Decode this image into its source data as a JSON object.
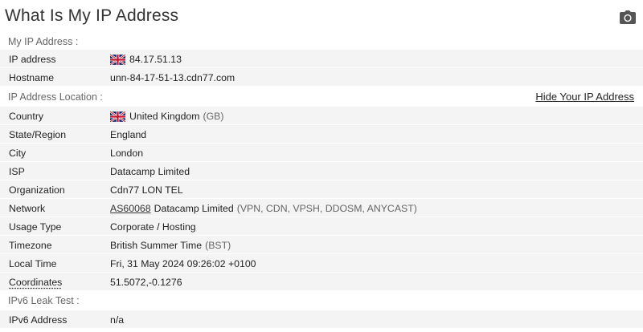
{
  "page": {
    "title": "What Is My IP Address"
  },
  "sections": {
    "my_ip": "My IP Address :",
    "location": "IP Address Location :",
    "ipv6": "IPv6 Leak Test :"
  },
  "hide_link": "Hide Your IP Address",
  "icons": {
    "camera": "camera-icon",
    "flag": "uk-flag-icon"
  },
  "ip": {
    "ip_label": "IP address",
    "ip_value": "84.17.51.13",
    "hostname_label": "Hostname",
    "hostname_value": "unn-84-17-51-13.cdn77.com"
  },
  "location": {
    "country_label": "Country",
    "country_value": "United Kingdom",
    "country_code": "(GB)",
    "state_label": "State/Region",
    "state_value": "England",
    "city_label": "City",
    "city_value": "London",
    "isp_label": "ISP",
    "isp_value": "Datacamp Limited",
    "org_label": "Organization",
    "org_value": "Cdn77 LON TEL",
    "network_label": "Network",
    "network_asn": "AS60068",
    "network_name": "Datacamp Limited",
    "network_extra": "(VPN, CDN, VPSH, DDOSM, ANYCAST)",
    "usage_label": "Usage Type",
    "usage_value": "Corporate / Hosting",
    "tz_label": "Timezone",
    "tz_value": "British Summer Time",
    "tz_abbr": "(BST)",
    "local_label": "Local Time",
    "local_value": "Fri, 31 May 2024 09:26:02 +0100",
    "coord_label": "Coordinates",
    "coord_value": "51.5072,-0.1276"
  },
  "ipv6": {
    "addr_label": "IPv6 Address",
    "addr_value": "n/a"
  }
}
